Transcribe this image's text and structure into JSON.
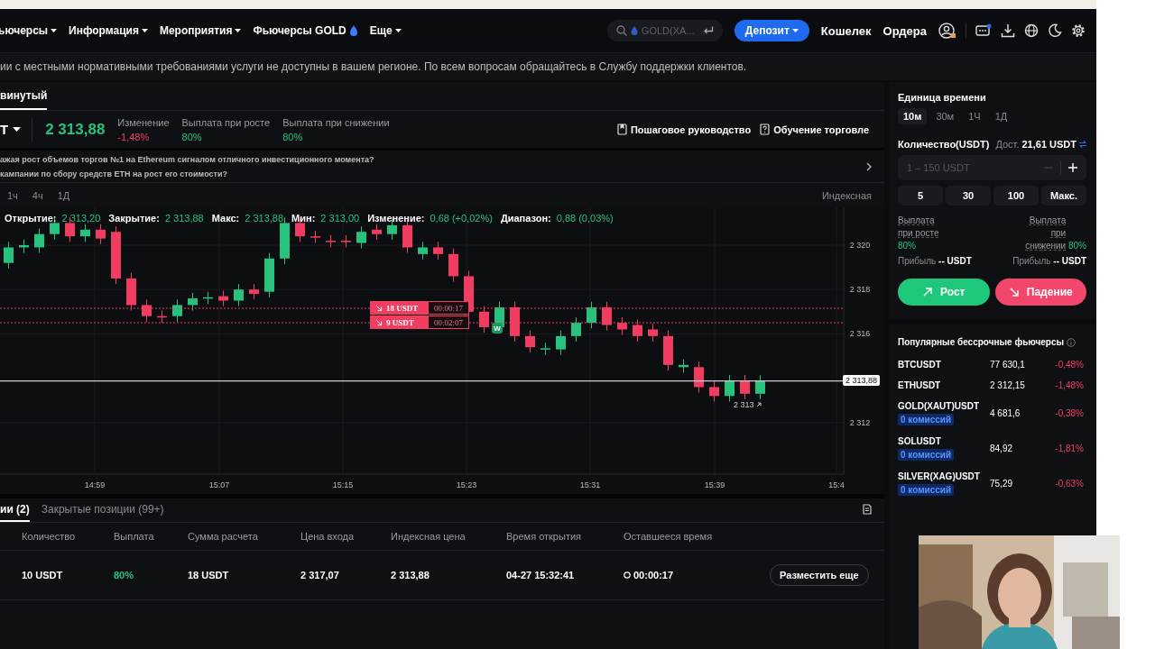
{
  "top_nav": {
    "items": [
      {
        "label": "ьючерсы",
        "kind": "menu"
      },
      {
        "label": "Информация",
        "kind": "menu"
      },
      {
        "label": "Мероприятия",
        "kind": "menu"
      },
      {
        "label": "Фьючерсы GOLD",
        "kind": "featured"
      },
      {
        "label": "Еще",
        "kind": "menu"
      }
    ],
    "search": {
      "placeholder": "GOLD(XA..."
    },
    "deposit_button": "Депозит",
    "links": [
      "Кошелек",
      "Ордера"
    ]
  },
  "notice": "ии с местными нормативными требованиями услуги не доступны в вашем регионе. По всем вопросам обращайтесь в Службу поддержки клиентов.",
  "mode_tabs": [
    {
      "label": "винутый",
      "selected": true
    }
  ],
  "instrument": {
    "symbol": "T",
    "price": "2 313,88",
    "stats": [
      {
        "label": "Изменение",
        "value": "-1,48%",
        "rising": false
      },
      {
        "label": "Выплата при росте",
        "value": "80%",
        "rising": true
      },
      {
        "label": "Выплата при снижении",
        "value": "80%",
        "rising": true
      }
    ]
  },
  "guide_links": [
    "Пошаговое руководство",
    "Обучение торговле"
  ],
  "announcements": [
    "ажая рост объемов торгов №1 на Ethereum сигналом отличного инвестиционного момента?",
    "кампании по сбору средств ETH на рост его стоимости?"
  ],
  "intervals": [
    {
      "label": "1ч",
      "selected": false
    },
    {
      "label": "4ч",
      "selected": false
    },
    {
      "label": "1Д",
      "selected": false
    }
  ],
  "price_source": "Индексная",
  "ohlc": [
    {
      "label": "Открытие:",
      "value": "2 313,20"
    },
    {
      "label": "Закрытие:",
      "value": "2 313,88"
    },
    {
      "label": "Макс:",
      "value": "2 313,88"
    },
    {
      "label": "Мин:",
      "value": "2 313,00"
    },
    {
      "label": "Изменение:",
      "value": "0,68 (+0,02%)"
    },
    {
      "label": "Диапазон:",
      "value": "0,88 (0,03%)"
    }
  ],
  "chart": {
    "y_labels": [
      "2 320",
      "2 318",
      "2 316",
      "2 312"
    ],
    "x_labels": [
      "14:59",
      "15:07",
      "15:15",
      "15:23",
      "15:31",
      "15:39",
      "15:4"
    ],
    "price_tag": "2 313,88",
    "last_label": "2 313",
    "marker": "W",
    "orders": [
      {
        "amount": "18 USDT",
        "timer": "00:00:17",
        "rising": false
      },
      {
        "amount": "9 USDT",
        "timer": "00:02:07",
        "rising": false
      }
    ]
  },
  "positions": {
    "tabs": [
      {
        "label": "ии (2)",
        "selected": true
      },
      {
        "label": "Закрытые позиции (99+)",
        "selected": false
      }
    ],
    "columns": [
      "Количество",
      "Выплата",
      "Сумма расчета",
      "Цена входа",
      "Индексная цена",
      "Время открытия",
      "Оставшееся время"
    ],
    "rows": [
      {
        "cells": [
          "10 USDT",
          "80%",
          "18 USDT",
          "2 317,07",
          "2 313,88",
          "04-27 15:32:41",
          "00:00:17"
        ],
        "action": "Разместить еще"
      }
    ]
  },
  "trade": {
    "time_unit_label": "Единица времени",
    "units": [
      {
        "label": "10м",
        "selected": true
      },
      {
        "label": "30м",
        "selected": false
      },
      {
        "label": "1Ч",
        "selected": false
      },
      {
        "label": "1Д",
        "selected": false
      }
    ],
    "quantity_label": "Количество(USDT)",
    "available_label": "Дост.",
    "available": "21,61 USDT",
    "amount_placeholder": "1 – 150 USDT",
    "quick_amounts": [
      "5",
      "30",
      "100",
      "Макс."
    ],
    "payouts": [
      {
        "label": "Выплата при росте",
        "value": "80%",
        "profit_label": "Прибыль",
        "profit": "-- USDT"
      },
      {
        "label": "Выплата при снижении",
        "value": "80%",
        "profit_label": "Прибыль",
        "profit": "-- USDT"
      }
    ],
    "buttons": [
      {
        "label": "Рост",
        "rising": true
      },
      {
        "label": "Падение",
        "rising": false
      }
    ]
  },
  "popular": {
    "title": "Популярные бессрочные фьючерсы",
    "items": [
      {
        "symbol": "BTCUSDT",
        "price": "77 630,1",
        "change": "-0,48%",
        "rising": false
      },
      {
        "symbol": "ETHUSDT",
        "price": "2 312,15",
        "change": "-1,48%",
        "rising": false
      },
      {
        "symbol": "GOLD(XAUT)USDT",
        "tag": "0 комиссий",
        "price": "4 681,6",
        "change": "-0,38%",
        "rising": false
      },
      {
        "symbol": "SOLUSDT",
        "tag": "0 комиссий",
        "price": "84,92",
        "change": "-1,81%",
        "rising": false
      },
      {
        "symbol": "SILVER(XAG)USDT",
        "tag": "0 комиссий",
        "price": "75,29",
        "change": "-0,63%",
        "rising": false
      }
    ]
  },
  "webcam": {
    "kind": "picture"
  }
}
